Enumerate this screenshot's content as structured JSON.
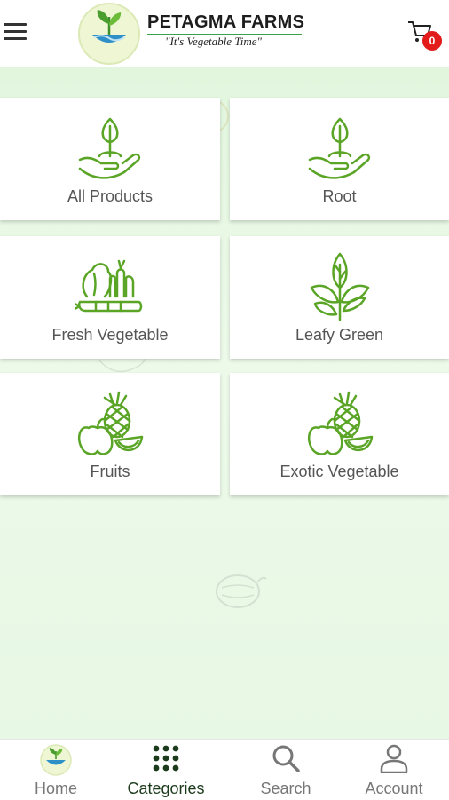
{
  "header": {
    "brand_name": "PETAGMA FARMS",
    "tagline": "\"It's Vegetable Time\"",
    "cart_count": "0",
    "menu_icon": "hamburger-icon",
    "cart_icon": "cart-icon",
    "badge_color": "#e21b1b"
  },
  "categories": [
    {
      "label": "All Products",
      "icon": "hand-sprout-icon"
    },
    {
      "label": "Root",
      "icon": "hand-sprout-icon"
    },
    {
      "label": "Fresh Vegetable",
      "icon": "vegetables-icon"
    },
    {
      "label": "Leafy Green",
      "icon": "leaves-icon"
    },
    {
      "label": "Fruits",
      "icon": "fruits-icon"
    },
    {
      "label": "Exotic Vegetable",
      "icon": "fruits-icon"
    }
  ],
  "bottom_nav": [
    {
      "label": "Home",
      "icon": "home-logo-icon",
      "active": false
    },
    {
      "label": "Categories",
      "icon": "grid-dots-icon",
      "active": true
    },
    {
      "label": "Search",
      "icon": "search-icon",
      "active": false
    },
    {
      "label": "Account",
      "icon": "user-icon",
      "active": false
    }
  ],
  "colors": {
    "accent_green": "#5aa526",
    "background_tint": "#e7f8e4",
    "active_nav": "#1c3a1c"
  }
}
